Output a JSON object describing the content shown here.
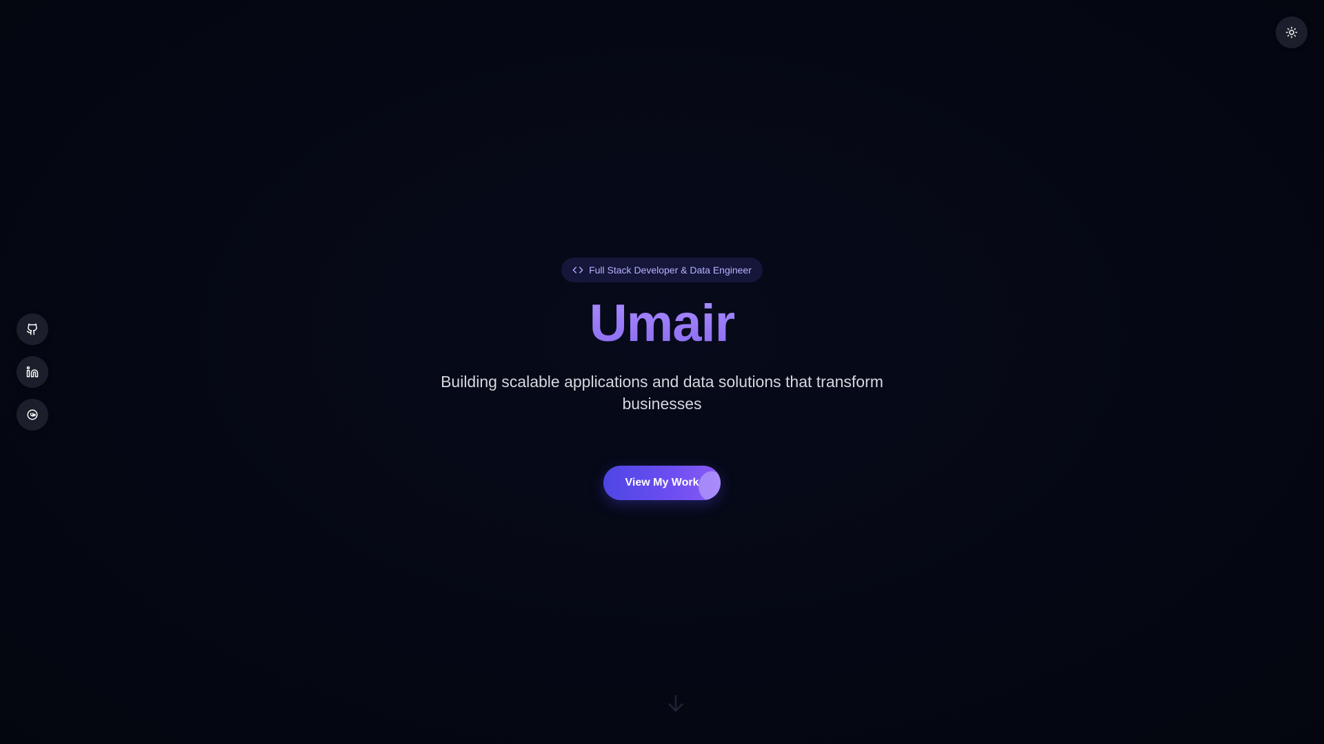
{
  "header": {
    "theme_toggle_icon": "sun-icon"
  },
  "social": {
    "items": [
      {
        "icon": "github-icon"
      },
      {
        "icon": "linkedin-icon"
      },
      {
        "icon": "upwork-icon"
      }
    ]
  },
  "hero": {
    "badge_icon": "code-icon",
    "badge_label": "Full Stack Developer & Data Engineer",
    "title": "Umair",
    "subtitle": "Building scalable applications and data solutions that transform businesses",
    "cta_label": "View My Work"
  },
  "scroll": {
    "icon": "arrow-down-icon"
  },
  "colors": {
    "background": "#050814",
    "accent": "#8b5cf6",
    "badge_bg": "#14163a",
    "icon_button_bg": "#1c1f2b"
  }
}
